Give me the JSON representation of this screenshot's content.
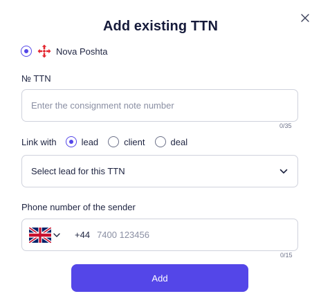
{
  "dialog": {
    "title": "Add existing TTN",
    "close_icon": "close-icon"
  },
  "provider": {
    "name": "Nova Poshta",
    "selected": true,
    "logo_icon": "nova-poshta-logo-icon",
    "logo_color": "#e3262e"
  },
  "ttn": {
    "label": "№ TTN",
    "placeholder": "Enter the consignment note number",
    "value": "",
    "counter": "0/35"
  },
  "link": {
    "label": "Link with",
    "options": [
      {
        "label": "lead",
        "selected": true
      },
      {
        "label": "client",
        "selected": false
      },
      {
        "label": "deal",
        "selected": false
      }
    ]
  },
  "lead_select": {
    "value": "Select lead for this TTN",
    "icon": "chevron-down-icon"
  },
  "phone": {
    "label": "Phone number of the sender",
    "country_flag": "uk-flag-icon",
    "dial_code": "+44",
    "placeholder": "7400 123456",
    "value": "",
    "counter": "0/15"
  },
  "actions": {
    "add_label": "Add"
  },
  "colors": {
    "accent": "#5446e8",
    "text": "#1d2340",
    "border": "#cfd2dc",
    "placeholder": "#8a8fa3"
  }
}
